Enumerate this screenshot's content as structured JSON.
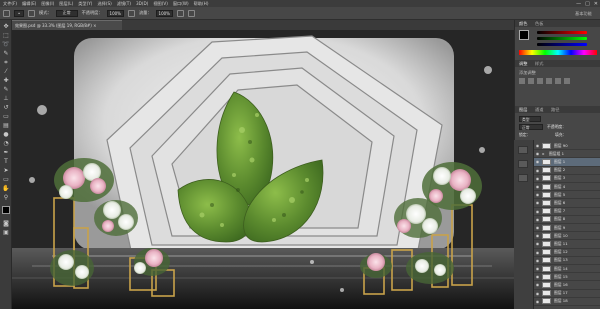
{
  "menubar": {
    "items": [
      "文件(F)",
      "编辑(E)",
      "图像(I)",
      "图层(L)",
      "类型(Y)",
      "选择(S)",
      "滤镜(T)",
      "3D(D)",
      "视图(V)",
      "窗口(W)",
      "帮助(H)"
    ],
    "window_controls": [
      "—",
      "□",
      "✕"
    ]
  },
  "optionsbar": {
    "mode_label": "模式：",
    "mode_value": "正常",
    "opacity_label": "不透明度：",
    "opacity_value": "100%",
    "flow_label": "流量：",
    "flow_value": "100%"
  },
  "document": {
    "tab_title": "效果图.psd @ 33.3% (图层 19, RGB/8#) ×"
  },
  "panels": {
    "color_tab": "颜色",
    "swatches_tab": "色板",
    "adjust_tab": "调整",
    "style_tab": "样式",
    "add_adjust": "添加调整",
    "layers_tab": "图层",
    "channels_tab": "通道",
    "paths_tab": "路径",
    "kind_label": "类型",
    "blend_mode": "正常",
    "opacity_label": "不透明度：",
    "lock_label": "锁定：",
    "fill_label": "填充：",
    "essentials": "基本功能"
  },
  "layers": [
    {
      "name": "图层 90"
    },
    {
      "name": "图层组 1"
    },
    {
      "name": "图层 1"
    },
    {
      "name": "图层 2"
    },
    {
      "name": "图层 3"
    },
    {
      "name": "图层 4"
    },
    {
      "name": "图层 5"
    },
    {
      "name": "图层 6"
    },
    {
      "name": "图层 7"
    },
    {
      "name": "图层 8"
    },
    {
      "name": "图层 9"
    },
    {
      "name": "图层 10"
    },
    {
      "name": "图层 11"
    },
    {
      "name": "图层 12"
    },
    {
      "name": "图层 13"
    },
    {
      "name": "图层 14"
    },
    {
      "name": "图层 15"
    },
    {
      "name": "图层 16"
    },
    {
      "name": "图层 17"
    },
    {
      "name": "图层 18"
    }
  ],
  "colors": {
    "accent": "#5d6b7a",
    "canvas_bg": "#282828",
    "leaf_green": "#6a9a3a"
  }
}
